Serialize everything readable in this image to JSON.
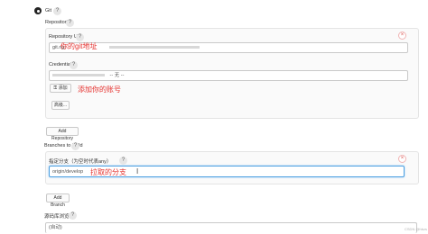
{
  "scm": {
    "git_label": "Git",
    "repositories_label": "Repositories",
    "repo_url_label": "Repository URL",
    "repo_url_value": "git.ngt",
    "repo_url_annotation": "你的git地址",
    "credentials_label": "Credentials",
    "credentials_value": "-- 无 --",
    "add_button": "添加",
    "credentials_annotation": "添加你的账号",
    "advanced_button": "高级...",
    "add_repository_button": "Add Repository",
    "branches_label": "Branches to build",
    "branch_specifier_label": "指定分支（为空时代表any）",
    "branch_value": "origin/develop",
    "branch_annotation": "拉取的分支",
    "add_branch_button": "Add Branch",
    "repo_browser_label": "源码库浏览器",
    "repo_browser_value": "(自动)",
    "watermark": "CSDN @hbzs"
  },
  "colors": {
    "annotation": "#e5312e",
    "focus_border": "#4b9fe1"
  }
}
